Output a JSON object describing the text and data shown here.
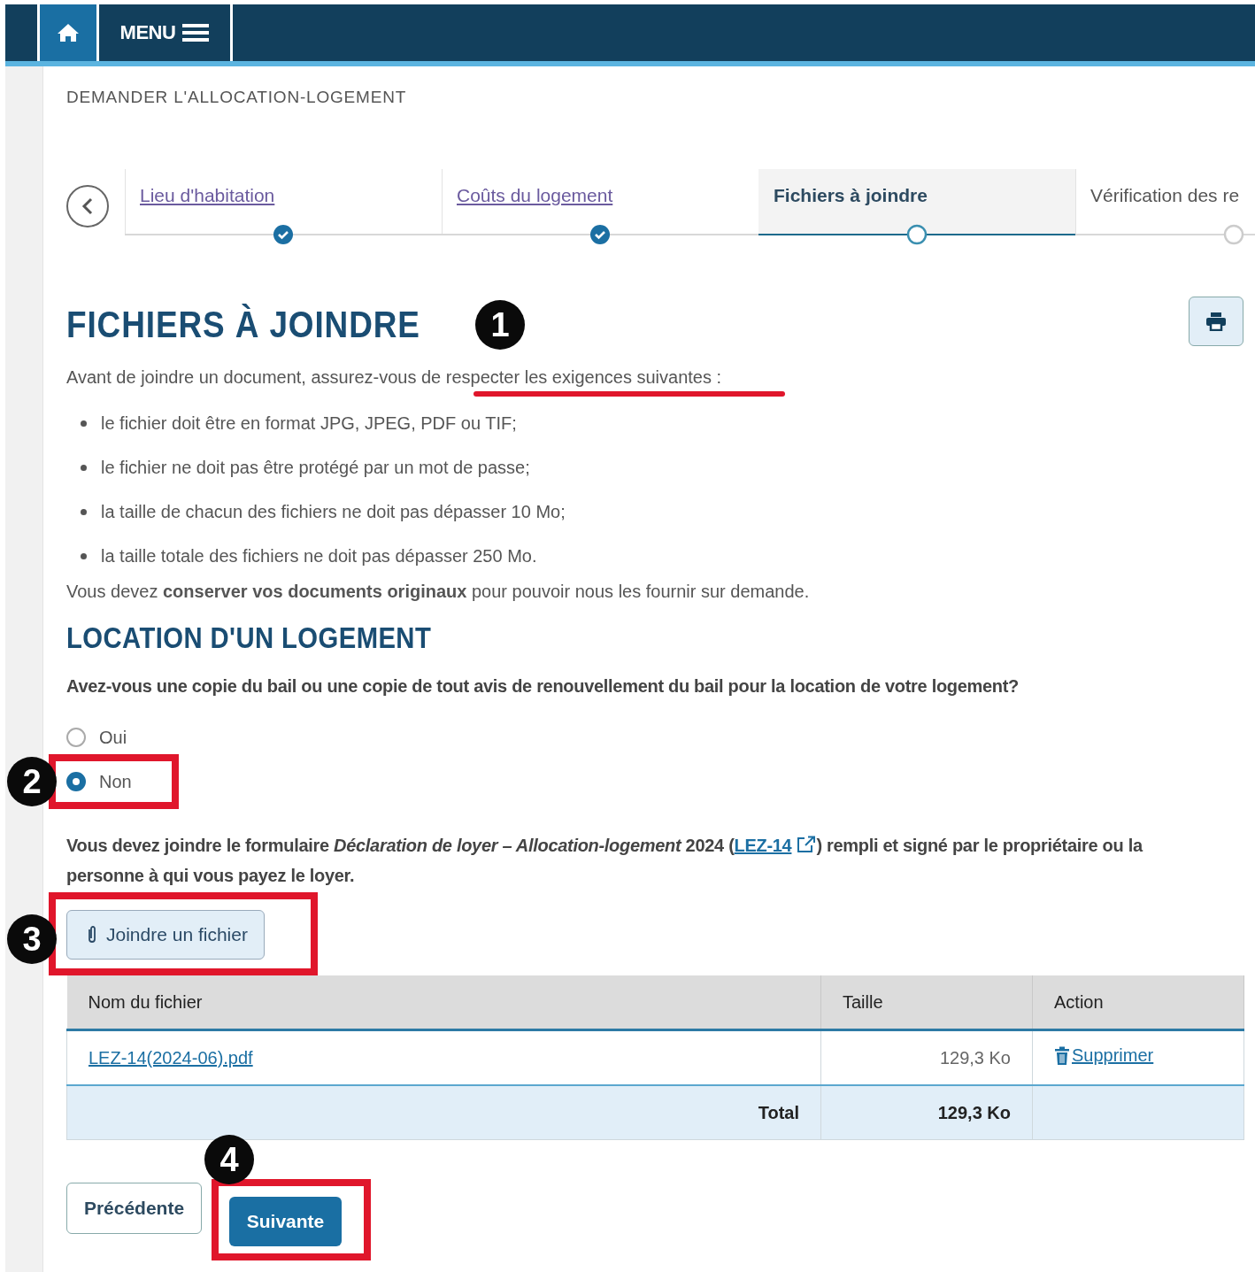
{
  "top_bar": {
    "menu_label": "MENU"
  },
  "breadcrumb": "DEMANDER L'ALLOCATION-LOGEMENT",
  "steps": [
    {
      "label": "Lieu d'habitation",
      "completed": true,
      "selected": false
    },
    {
      "label": "Coûts du logement",
      "completed": true,
      "selected": false
    },
    {
      "label": "Fichiers à joindre",
      "completed": false,
      "selected": true
    },
    {
      "label": "Vérification des re",
      "completed": false,
      "selected": false
    }
  ],
  "title": "FICHIERS À JOINDRE",
  "intro": {
    "text": "Avant de joindre un document, assurez-vous de respecter les exigences suivantes :",
    "callout": {
      "number": "1",
      "kind": "underline"
    }
  },
  "requirements": [
    "le fichier doit être en format JPG, JPEG, PDF ou TIF;",
    "le fichier ne doit pas être protégé par un mot de passe;",
    "la taille de chacun des fichiers ne doit pas dépasser 10 Mo;",
    "la taille totale des fichiers ne doit pas dépasser 250 Mo."
  ],
  "keep_note": "Vous devez **conserver vos documents originaux** pour pouvoir nous les fournir sur demande.",
  "section_title": "LOCATION D'UN LOGEMENT",
  "question": "Avez-vous une copie du bail ou une copie de tout avis de renouvellement du bail pour la location de votre logement?",
  "options": [
    {
      "label": "Oui",
      "selected": false
    },
    {
      "label": "Non",
      "selected": true,
      "callout": {
        "number": "2",
        "kind": "frame"
      }
    }
  ],
  "instruction": {
    "before": "Vous devez joindre le formulaire *Déclaration de loyer – Allocation-logement* 2024 (",
    "link": "LEZ-14",
    "after": ") rempli et signé par le propriétaire ou la personne à qui vous payez le loyer."
  },
  "attach_button": {
    "label": "Joindre un fichier",
    "callout": {
      "number": "3",
      "kind": "frame"
    }
  },
  "table": {
    "columns": [
      "Nom du fichier",
      "Taille",
      "Action"
    ],
    "rows": [
      {
        "file": "LEZ-14(2024-06).pdf",
        "size": "129,3 Ko",
        "action": "Supprimer"
      }
    ],
    "total": {
      "label": "Total",
      "size": "129,3 Ko"
    }
  },
  "prev_button": {
    "label": "Précédente"
  },
  "next_button": {
    "label": "Suivante",
    "callout": {
      "number": "4",
      "kind": "frame"
    }
  }
}
